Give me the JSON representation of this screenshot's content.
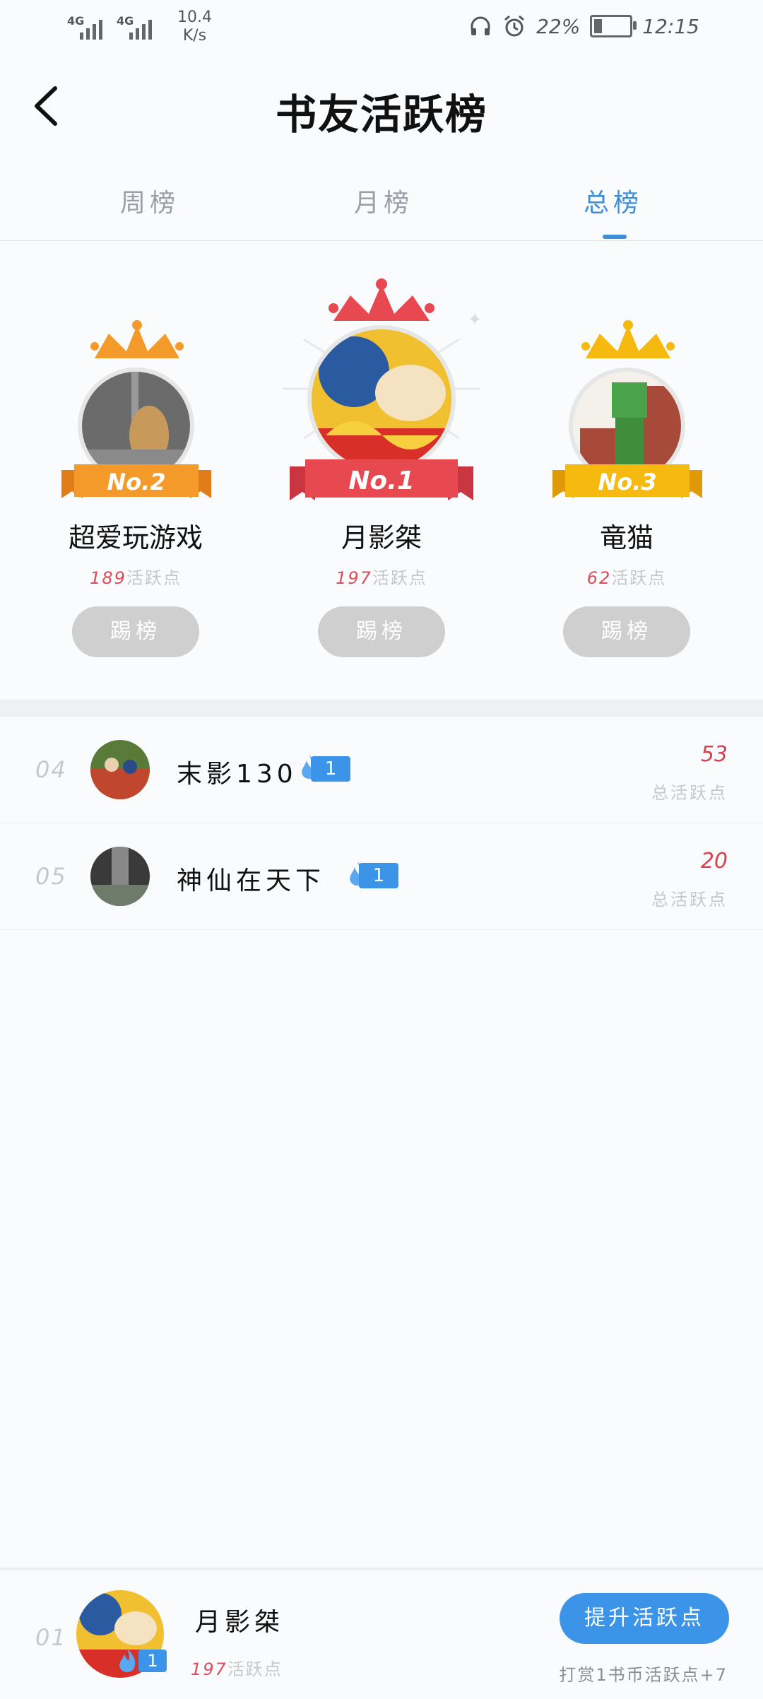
{
  "status_bar": {
    "signal_1": "4G",
    "signal_2": "4G",
    "speed_value": "10.4",
    "speed_unit": "K/s",
    "battery_percent": "22%",
    "time": "12:15"
  },
  "header": {
    "title": "书友活跃榜"
  },
  "tabs": [
    {
      "label": "周榜",
      "active": false
    },
    {
      "label": "月榜",
      "active": false
    },
    {
      "label": "总榜",
      "active": true
    }
  ],
  "podium": [
    {
      "rank_badge": "No.2",
      "name": "超爱玩游戏",
      "points": "189",
      "points_suffix": "活跃点",
      "kick_label": "踢榜"
    },
    {
      "rank_badge": "No.1",
      "name": "月影桀",
      "points": "197",
      "points_suffix": "活跃点",
      "kick_label": "踢榜"
    },
    {
      "rank_badge": "No.3",
      "name": "竜猫",
      "points": "62",
      "points_suffix": "活跃点",
      "kick_label": "踢榜"
    }
  ],
  "list": [
    {
      "rank": "04",
      "name": "末影130",
      "fire_level": "1",
      "score": "53",
      "score_label": "总活跃点"
    },
    {
      "rank": "05",
      "name": "神仙在天下",
      "fire_level": "1",
      "score": "20",
      "score_label": "总活跃点"
    }
  ],
  "me": {
    "rank": "01",
    "name": "月影桀",
    "fire_level": "1",
    "points": "197",
    "points_suffix": "活跃点",
    "boost_label": "提升活跃点",
    "tip": "打赏1书币活跃点+7"
  },
  "colors": {
    "accent": "#3b94e8",
    "score_red": "#d9434f",
    "gold_no1": "#e84850",
    "orange_no2": "#f39a2a",
    "yellow_no3": "#f5b910"
  }
}
